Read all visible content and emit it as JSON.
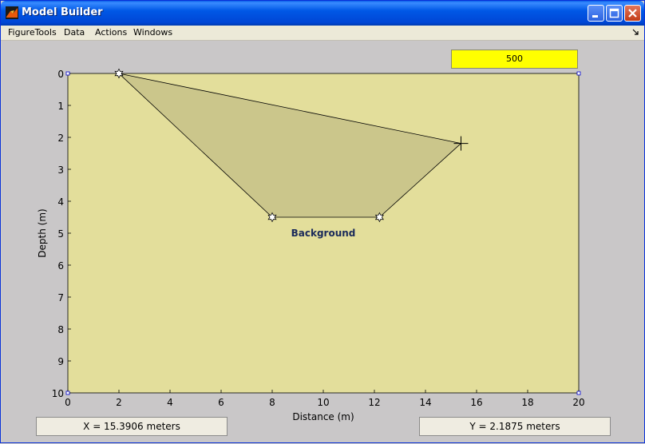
{
  "window": {
    "title": "Model Builder",
    "colors": {
      "titlebar": "#0054e3",
      "menubar": "#ece9d8",
      "client_bg": "#c9c7c8",
      "axes_bg": "#e3de9b",
      "polygon_fill": "#cbc68b",
      "value_box": "#ffff00"
    },
    "titlebar_icons": [
      "matlab-logo-icon",
      "minimize-icon",
      "maximize-icon",
      "close-icon"
    ]
  },
  "menu": {
    "items": [
      {
        "label": "FigureTools"
      },
      {
        "label": "Data"
      },
      {
        "label": "Actions"
      },
      {
        "label": "Windows"
      }
    ],
    "dock_icon": "dock-arrow-icon"
  },
  "value_box": {
    "text": "500"
  },
  "readouts": {
    "x": "X = 15.3906 meters",
    "y": "Y = 2.1875 meters"
  },
  "chart_data": {
    "type": "scatter",
    "xlabel": "Distance (m)",
    "ylabel": "Depth (m)",
    "xlim": [
      0,
      20
    ],
    "ylim": [
      0,
      10
    ],
    "y_reversed": true,
    "x_ticks": [
      0,
      2,
      4,
      6,
      8,
      10,
      12,
      14,
      16,
      18,
      20
    ],
    "y_ticks": [
      0,
      1,
      2,
      3,
      4,
      5,
      6,
      7,
      8,
      9,
      10
    ],
    "grid": false,
    "polygon": {
      "label": "Background",
      "vertices": [
        {
          "x": 2.0,
          "y": 0.0
        },
        {
          "x": 15.39,
          "y": 2.19
        },
        {
          "x": 12.2,
          "y": 4.5
        },
        {
          "x": 8.0,
          "y": 4.5
        }
      ],
      "label_position": {
        "x": 10.0,
        "y": 5.0
      }
    },
    "cursor": {
      "x": 15.39,
      "y": 2.19
    }
  }
}
